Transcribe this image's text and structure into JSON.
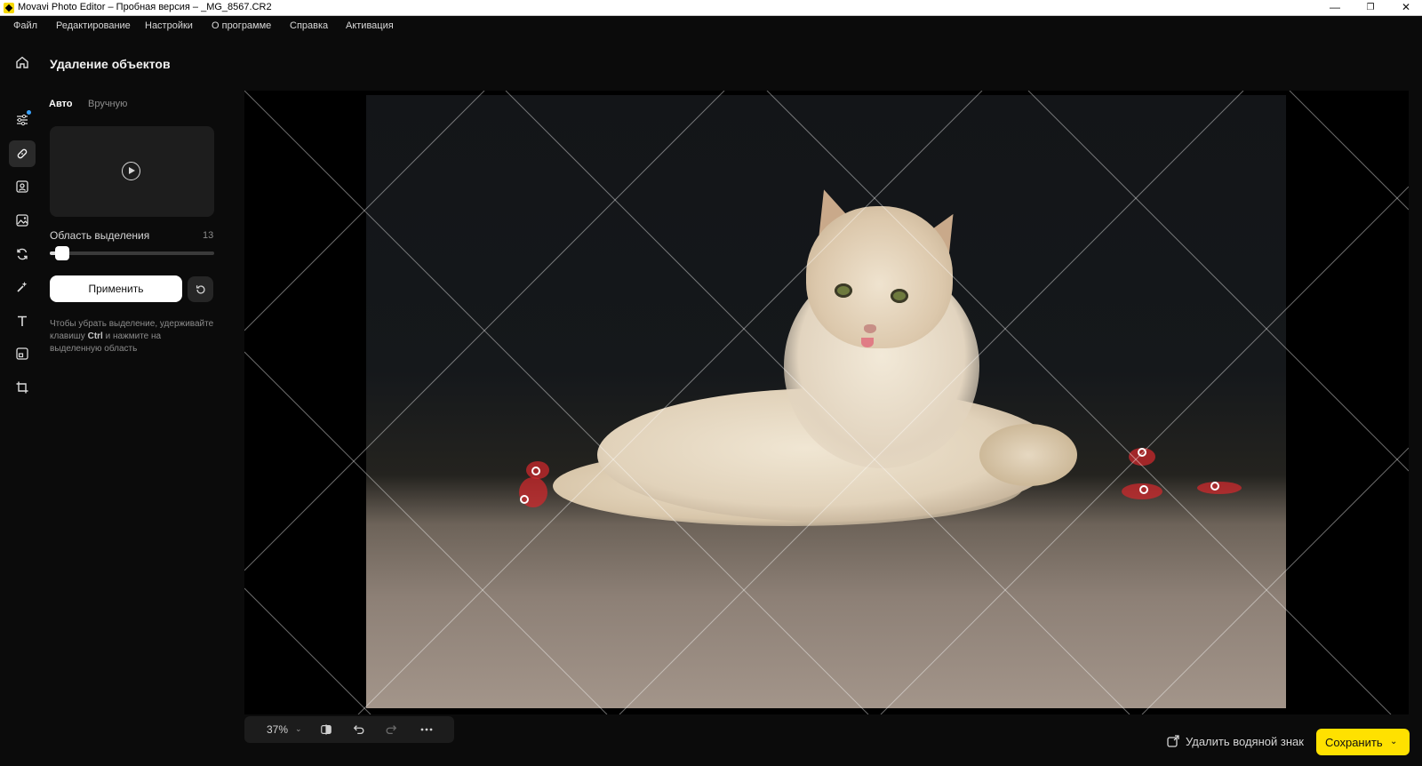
{
  "window": {
    "title": "Movavi Photo Editor – Пробная версия – _MG_8567.CR2",
    "min_label": "—",
    "max_label": "❐",
    "close_label": "✕"
  },
  "menu": [
    "Файл",
    "Редактирование",
    "Настройки",
    "О программе",
    "Справка",
    "Активация"
  ],
  "toolbar": {
    "tools": [
      "home-icon",
      "adjust-sliders-icon",
      "healing-patch-icon",
      "portrait-icon",
      "image-enhance-icon",
      "rotate-icon",
      "magic-icon",
      "text-icon",
      "watermark-icon",
      "crop-icon"
    ],
    "active_tool": "healing-patch-icon"
  },
  "panel": {
    "title": "Удаление объектов",
    "tabs": [
      "Авто",
      "Вручную"
    ],
    "active_tab": "Авто",
    "slider_label": "Область выделения",
    "slider_value": "13",
    "apply_label": "Применить",
    "hint_pre": "Чтобы убрать выделение, удерживайте клавишу ",
    "hint_key": "Ctrl",
    "hint_post": " и нажмите на выделенную область"
  },
  "bottom": {
    "zoom": "37%",
    "zoom_caret": "⌄",
    "watermark_label": "Удалить водяной знак",
    "save_label": "Сохранить",
    "save_caret": "⌄"
  },
  "colors": {
    "accent": "#ffe100",
    "selection": "#d2282d",
    "indicator": "#3aa3ff"
  }
}
